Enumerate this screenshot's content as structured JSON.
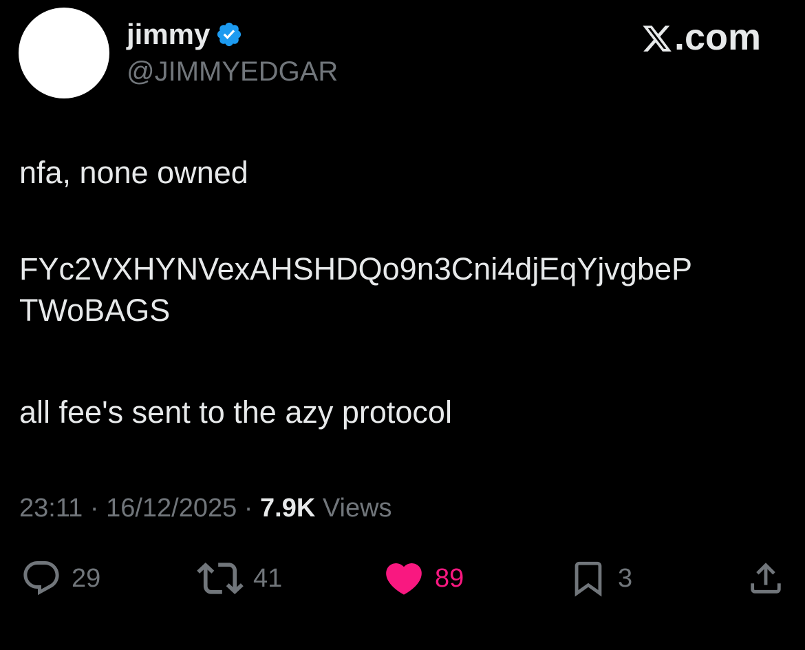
{
  "author": {
    "display_name": "jimmy",
    "handle": "@JIMMYEDGAR",
    "verified_color": "#1d9bf0"
  },
  "brand": {
    "label": ".com",
    "icon": "x-logo-icon"
  },
  "tweet": {
    "lines": [
      "nfa, none owned",
      "FYc2VXHYNVexAHSHDQo9n3Cni4djEqYjvgbeP",
      "TWoBAGS",
      "all fee's sent to the azy protocol"
    ]
  },
  "meta": {
    "time": "23:11",
    "separator": " · ",
    "date": "16/12/2025",
    "views_count": "7.9K",
    "views_label": "Views"
  },
  "actions": {
    "reply": {
      "icon": "reply-icon",
      "count": "29"
    },
    "repost": {
      "icon": "repost-icon",
      "count": "41"
    },
    "like": {
      "icon": "heart-icon",
      "count": "89",
      "active_color": "#f91880"
    },
    "bookmark": {
      "icon": "bookmark-icon",
      "count": "3"
    },
    "share": {
      "icon": "share-icon"
    }
  },
  "colors": {
    "background": "#000000",
    "text_primary": "#e7e9ea",
    "text_secondary": "#71767b"
  }
}
